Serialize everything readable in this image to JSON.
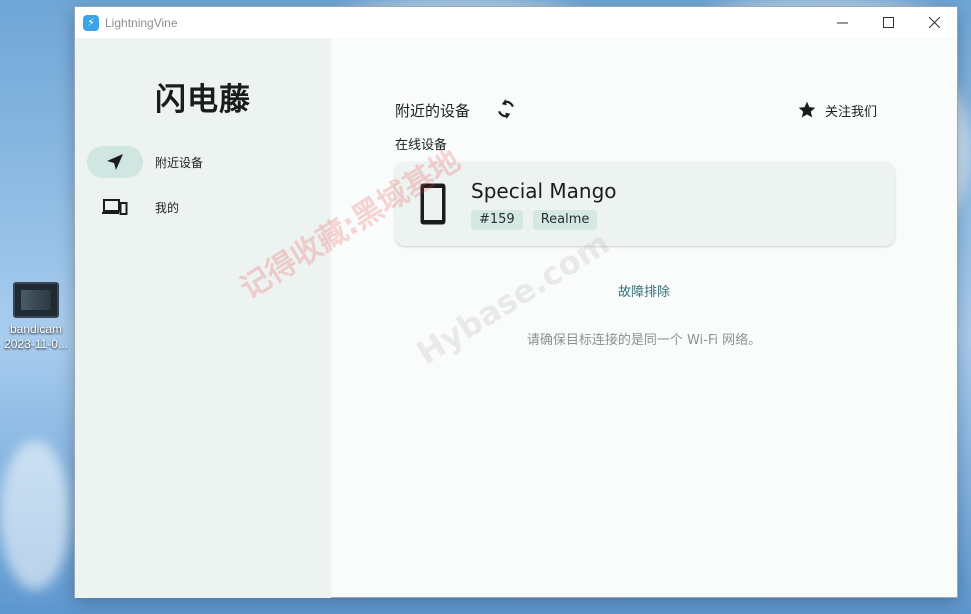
{
  "window": {
    "title": "LightningVine"
  },
  "desktop": {
    "icon_label_line1": "bandicam",
    "icon_label_line2": "2023-11-0..."
  },
  "sidebar": {
    "brand": "闪电藤",
    "items": [
      {
        "label": "附近设备",
        "icon": "navigation-arrow-icon",
        "active": true
      },
      {
        "label": "我的",
        "icon": "devices-icon",
        "active": false
      }
    ]
  },
  "main": {
    "section_title": "附近的设备",
    "follow_label": "关注我们",
    "subheading": "在线设备",
    "device": {
      "name": "Special Mango",
      "tags": [
        "#159",
        "Realme"
      ],
      "icon": "smartphone-icon"
    },
    "troubleshoot_label": "故障排除",
    "hint": "请确保目标连接的是同一个 Wi-Fi 网络。"
  },
  "watermark": {
    "text": "记得收藏:黑域基地",
    "text2": "Hybase.com"
  },
  "colors": {
    "accent": "#2f6f7c",
    "sidebar_bg": "#edf3f1",
    "active_pill": "#cfe6e1",
    "tag_bg": "#d4e9e4"
  }
}
